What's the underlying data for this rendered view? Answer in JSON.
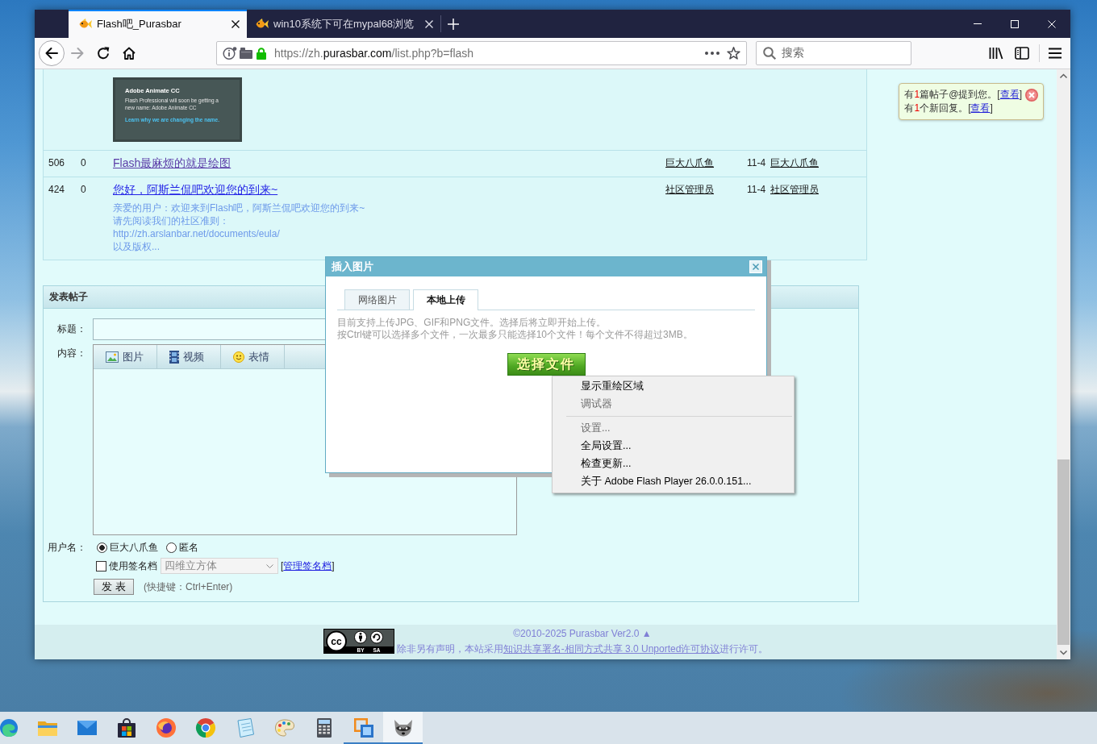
{
  "browser": {
    "tabs": [
      {
        "title": "Flash吧_Purasbar",
        "selected": true
      },
      {
        "title": "win10系统下可在mypal68浏览",
        "selected": false
      }
    ],
    "address": {
      "prefix": "https://zh.",
      "domain": "purasbar.com",
      "path": "/list.php?b=flash"
    },
    "search": {
      "placeholder": "搜索"
    }
  },
  "topics": {
    "rows": [
      {
        "kind": "continued",
        "image": {
          "title": "Adobe Animate CC",
          "text": "Flash Professional will soon be getting a new name: Adobe Animate CC",
          "link": "Learn why we are changing the name."
        }
      },
      {
        "kind": "topic",
        "column_1": "506",
        "column_2": "0",
        "title": "Flash最麻烦的就是绘图",
        "visited": true,
        "author": "巨大八爪鱼",
        "date": "11-4",
        "last_poster": "巨大八爪鱼"
      },
      {
        "kind": "topic",
        "column_1": "424",
        "column_2": "0",
        "title": "您好，阿斯兰侃吧欢迎您的到来~",
        "visited": false,
        "excerpt": [
          "亲爱的用户：欢迎来到Flash吧，阿斯兰侃吧欢迎您的到来~",
          "请先阅读我们的社区准则：",
          "http://zh.arslanbar.net/documents/eula/",
          "以及版权..."
        ],
        "author": "社区管理员",
        "date": "11-4",
        "last_poster": "社区管理员"
      }
    ]
  },
  "notice": {
    "lines": [
      {
        "prefix": "有",
        "count": "1",
        "text": "篇帖子@提到您。[",
        "link": "查看",
        "end": "]"
      },
      {
        "prefix": "有",
        "count": "1",
        "text": "个新回复。[",
        "link": "查看",
        "end": "]"
      }
    ]
  },
  "post_form": {
    "title": "发表帖子",
    "subject": {
      "label": "标题："
    },
    "content": {
      "label": "内容：",
      "tools": [
        {
          "kind": "image",
          "label": "图片"
        },
        {
          "kind": "video",
          "label": "视频"
        },
        {
          "kind": "emoji",
          "label": "表情"
        }
      ]
    },
    "identity": {
      "label": "用户名：",
      "options": [
        {
          "label": "巨大八爪鱼",
          "selected": true
        },
        {
          "label": "匿名",
          "selected": false
        }
      ]
    },
    "signature": {
      "label": "使用签名档",
      "checked": false,
      "select": {
        "value": "四维立方体",
        "disabled": true
      },
      "manage": {
        "open": "[",
        "link": "管理签名档",
        "close": "]"
      }
    },
    "submit": "发 表",
    "hint": "(快捷键：Ctrl+Enter)"
  },
  "dialog": {
    "title": "插入图片",
    "tabs": [
      {
        "label": "网络图片",
        "selected": false
      },
      {
        "label": "本地上传",
        "selected": true
      }
    ],
    "notes": [
      "目前支持上传JPG、GIF和PNG文件。选择后将立即开始上传。",
      "按Ctrl键可以选择多个文件，一次最多只能选择10个文件！每个文件不得超过3MB。"
    ],
    "upload_button": "选择文件"
  },
  "context_menu": {
    "items": [
      {
        "kind": "item",
        "label": "显示重绘区域",
        "disabled": false
      },
      {
        "kind": "item",
        "label": "调试器",
        "disabled": true
      },
      {
        "kind": "separator"
      },
      {
        "kind": "item",
        "label": "设置...",
        "disabled": true
      },
      {
        "kind": "item",
        "label": "全局设置...",
        "disabled": false
      },
      {
        "kind": "item",
        "label": "检查更新...",
        "disabled": false
      },
      {
        "kind": "item",
        "label": "关于 Adobe Flash Player 26.0.0.151...",
        "disabled": false
      }
    ]
  },
  "footer": {
    "badge": {
      "logo": "cc",
      "left": "BY",
      "right": "SA"
    },
    "copyright": "©2010-2025 Purasbar Ver2.0 ▲",
    "license": {
      "before": "除非另有声明，本站采用",
      "link": "知识共享署名-相同方式共享 3.0 Unported许可协议",
      "after": "进行许可。"
    }
  },
  "taskbar": {
    "apps": [
      {
        "kind": "swirl",
        "running": false,
        "active": false
      },
      {
        "kind": "folder",
        "running": false,
        "active": false
      },
      {
        "kind": "mail",
        "running": false,
        "active": false
      },
      {
        "kind": "bag",
        "running": false,
        "active": false
      },
      {
        "kind": "fox",
        "running": false,
        "active": false
      },
      {
        "kind": "wheel",
        "running": false,
        "active": false
      },
      {
        "kind": "notepad",
        "running": false,
        "active": false
      },
      {
        "kind": "palette",
        "running": false,
        "active": false
      },
      {
        "kind": "calculator",
        "running": false,
        "active": false
      },
      {
        "kind": "squares",
        "running": true,
        "active": false
      },
      {
        "kind": "raccoon",
        "running": true,
        "active": true
      }
    ]
  }
}
